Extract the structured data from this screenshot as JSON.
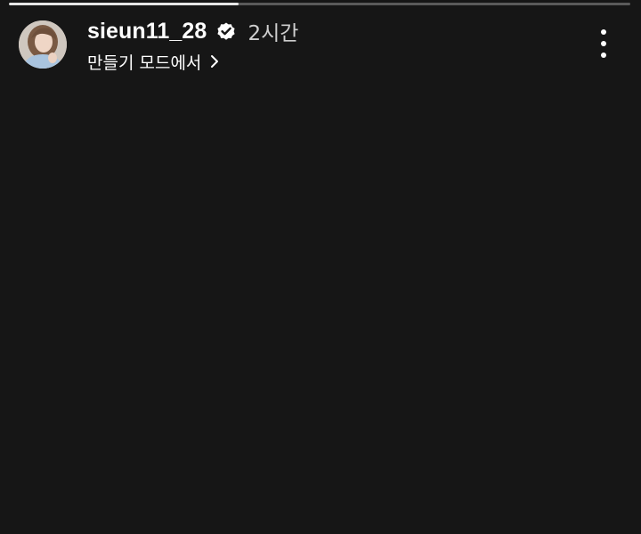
{
  "story": {
    "progress_fraction": 0.37,
    "username": "sieun11_28",
    "verified": true,
    "timestamp": "2시간",
    "subtitle": "만들기 모드에서",
    "icons": {
      "verified": "verified-badge-icon",
      "chevron": "chevron-right-icon",
      "more": "more-vertical-icon"
    }
  },
  "colors": {
    "background": "#161616",
    "progress_track": "#5a5a5a",
    "progress_fill": "#e6e6e6",
    "text_primary": "#ffffff",
    "text_secondary": "#cfcfcf"
  }
}
